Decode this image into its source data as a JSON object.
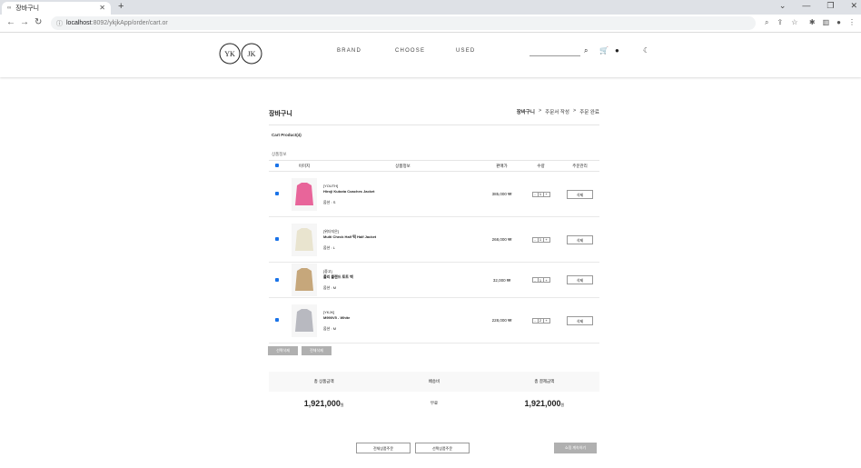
{
  "browser": {
    "tab_title": "장바구니",
    "tab_icon": "∞",
    "url_host": "localhost",
    "url_rest": ":8092/ykjkApp/order/cart.or"
  },
  "site": {
    "logo_left": "YK",
    "logo_right": "JK",
    "nav": [
      "BRAND",
      "CHOOSE",
      "USED"
    ]
  },
  "page": {
    "title": "장바구니",
    "breadcrumb": [
      "장바구니",
      ">",
      "주문서 작성",
      ">",
      "주문 완료"
    ],
    "cart_label": "Cart Product(4)",
    "section_label": "상품정보"
  },
  "table": {
    "headers": [
      "이미지",
      "상품정보",
      "판매가",
      "수량",
      "주문관리"
    ],
    "rows": [
      {
        "brand": "[YOUTH]",
        "name": "Hiroji Kubota Coaches Jacket",
        "option": "옵션 : S",
        "price": "385,000 ₩",
        "qty": "1",
        "action": "삭제",
        "color": "#e8659a"
      },
      {
        "brand": "[위더지은]",
        "name": "Multi Check Half 떡 Half Jacket",
        "option": "옵션 : L",
        "price": "268,000 ₩",
        "qty": "1",
        "action": "삭제",
        "color": "#e9e4cf"
      },
      {
        "brand": "[중고]",
        "name": "폴리 플랜드 토트 백",
        "option": "옵션 : M",
        "price": "32,000 ₩",
        "qty": "1",
        "action": "삭제",
        "color": "#c6a77b"
      },
      {
        "brand": "[YKJK]",
        "name": "M990V5 - White",
        "option": "옵션 : M",
        "price": "228,000 ₩",
        "qty": "2",
        "action": "삭제",
        "color": "#b8b9c0"
      }
    ],
    "delete_selected": "선택삭제",
    "delete_all": "전체삭제"
  },
  "summary": {
    "headers": [
      "총 상품금액",
      "배송비",
      "총 결제금액"
    ],
    "total_product": "1,921,000",
    "shipping": "무료",
    "total_payment": "1,921,000",
    "won": "원"
  },
  "actions": {
    "order_all": "전체상품주문",
    "order_selected": "선택상품주문",
    "continue_shopping": "쇼핑 계속하기"
  },
  "colors": {
    "accent": "#1a73e8",
    "gray_button": "#b0b0b0"
  }
}
